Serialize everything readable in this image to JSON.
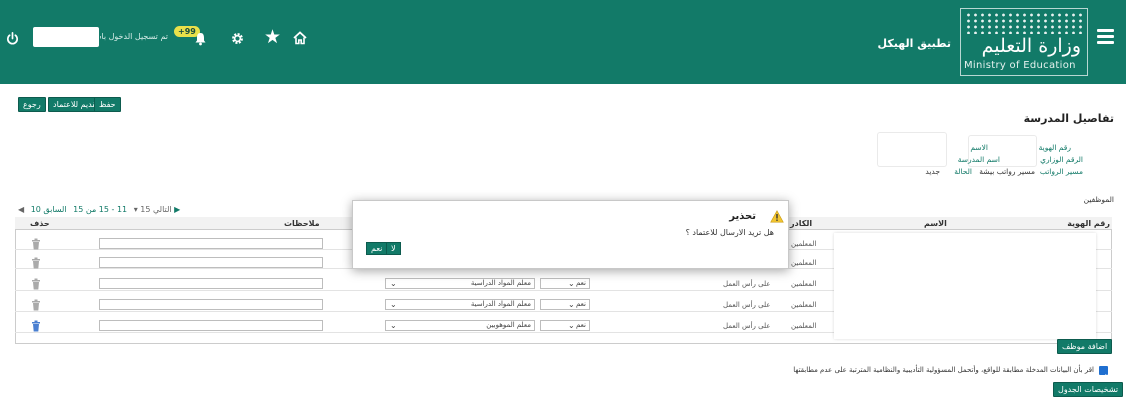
{
  "header": {
    "app_title": "تطبيق الهيكل",
    "logo_ar": "وزارة التعليم",
    "logo_en": "Ministry of Education",
    "login_text": "تم تسجيل الدخول باسم",
    "notification_count": "+99",
    "icons": [
      "menu-icon",
      "power-icon",
      "bell-icon",
      "gear-icon",
      "star-icon",
      "home-icon"
    ],
    "colors": {
      "primary": "#127a68",
      "badge": "#e9e04a"
    }
  },
  "toolbar": {
    "back_label": "رجوع",
    "submit_label": "تقديم للاعتماد",
    "save_label": "حفظ"
  },
  "details": {
    "title": "تفاصيل المدرسة",
    "id_label": "رقم الهوية",
    "name_label": "الاسم",
    "ministry_no_label": "الرقم الوزاري",
    "school_name_label": "اسم المدرسة",
    "salary_label": "مسير الرواتب",
    "salary_value": "مسير رواتب بيشة",
    "status_label": "الحالة",
    "status_value": "جديد"
  },
  "staff": {
    "title": "الموظفين",
    "pager": {
      "next": "التالي",
      "range": "11 - 15 من 15",
      "prev": "السابق 10"
    },
    "columns": {
      "id": "رقم الهوية",
      "name": "الاسم",
      "cadre": "الكادر",
      "notes": "ملاحظات",
      "delete": "حذف"
    },
    "rows": [
      {
        "cadre": "المعلمين",
        "work": "",
        "yes": "",
        "role": ""
      },
      {
        "cadre": "المعلمين",
        "work": "",
        "yes": "",
        "role": ""
      },
      {
        "cadre": "المعلمين",
        "work": "على رأس العمل",
        "yes": "نعم",
        "role": "معلم المواد الدراسية"
      },
      {
        "cadre": "المعلمين",
        "work": "على رأس العمل",
        "yes": "نعم",
        "role": "معلم المواد الدراسية"
      },
      {
        "cadre": "المعلمين",
        "work": "على رأس العمل",
        "yes": "نعم",
        "role": "معلم الموهوبين"
      }
    ],
    "add_label": "اضافة موظف"
  },
  "ack": {
    "text": "اقر بأن البيانات المدخلة مطابقة للواقع، وأتحمل المسؤولية التأديبية والنظامية المترتبة على عدم مطابقتها",
    "checked": true,
    "schedule_label": "تشخيصات الجدول"
  },
  "dialog": {
    "title": "تحذير",
    "message": "هل تريد الارسال للاعتماد ؟",
    "yes_label": "نعم",
    "no_label": "لا"
  }
}
